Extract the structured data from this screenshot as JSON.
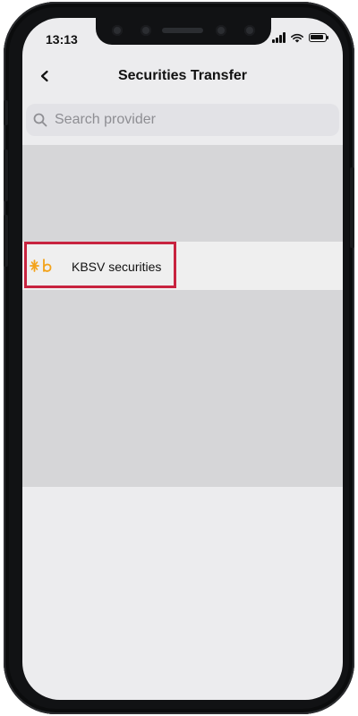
{
  "status_bar": {
    "time": "13:13"
  },
  "nav": {
    "title": "Securities Transfer",
    "back_icon": "chevron-left-icon"
  },
  "search": {
    "placeholder": "Search provider",
    "value": ""
  },
  "providers": [
    {
      "name": "KBSV securities",
      "icon": "kbsv-logo",
      "highlighted": true
    }
  ],
  "colors": {
    "highlight_border": "#c8233f",
    "kbsv_orange": "#f3a31b"
  }
}
